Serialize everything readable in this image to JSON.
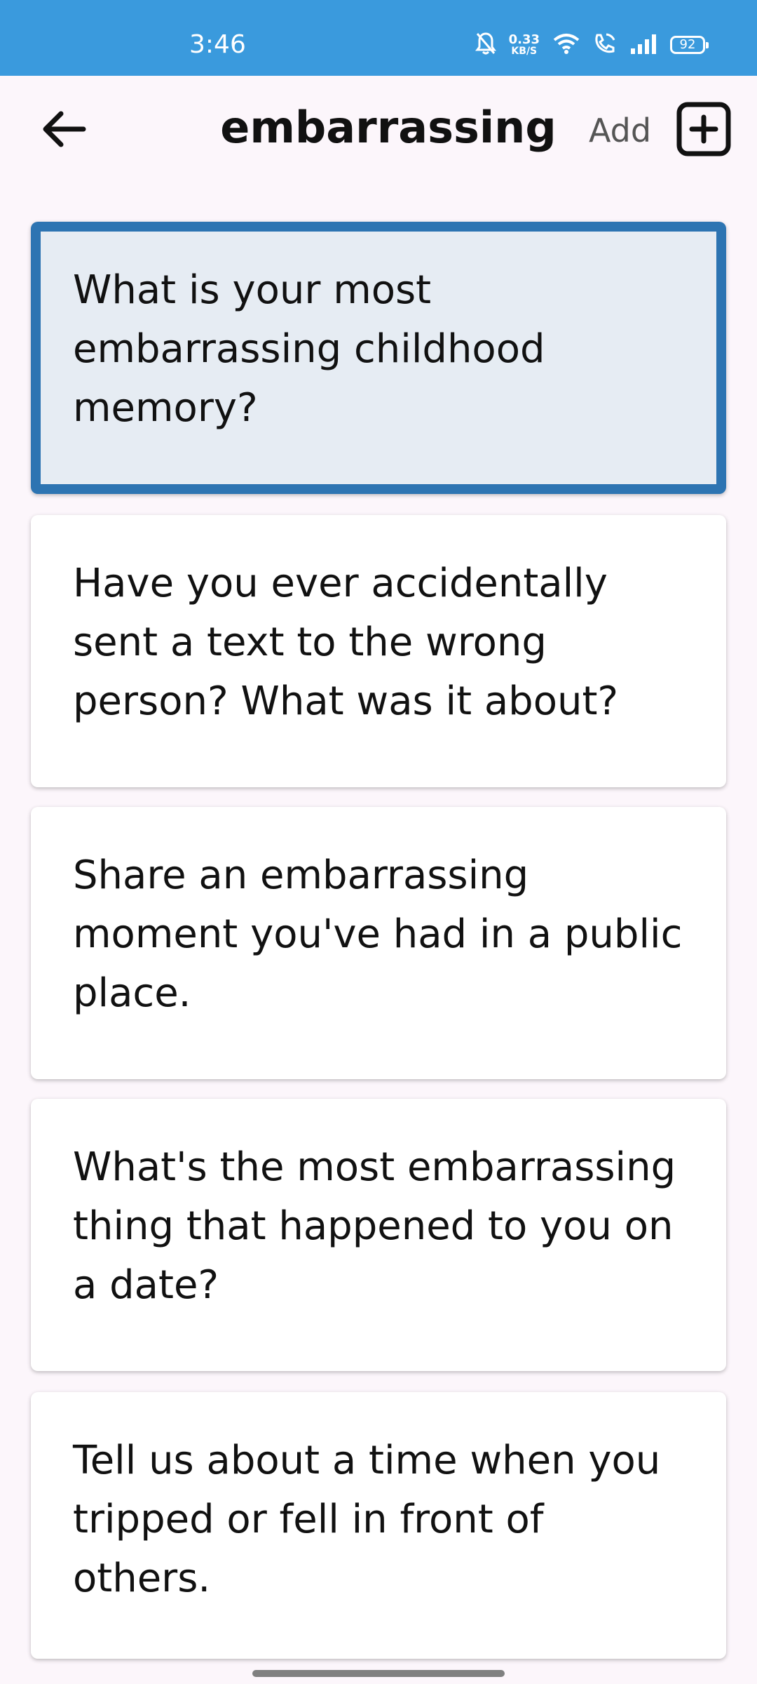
{
  "status_bar": {
    "time": "3:46",
    "net_speed_value": "0.33",
    "net_speed_unit": "KB/S",
    "battery": "92",
    "icons": [
      "bell-off-icon",
      "wifi-icon",
      "wifi-calling-icon",
      "signal-icon",
      "battery-icon"
    ]
  },
  "header": {
    "title": "embarrassing",
    "add_label": "Add",
    "back_icon": "arrow-left-icon",
    "add_icon": "plus-square-icon"
  },
  "colors": {
    "status_bar": "#3a9add",
    "selected_border": "#2d74b2",
    "selected_fill": "#e6ecf3",
    "background": "#fcf6fb"
  },
  "questions": [
    {
      "text": "What is your most embarrassing childhood memory?",
      "selected": true
    },
    {
      "text": "Have you ever accidentally sent a text to the wrong person? What was it about?",
      "selected": false
    },
    {
      "text": "Share an embarrassing moment you've had in a public place.",
      "selected": false
    },
    {
      "text": "What's the most embarrassing thing that happened to you on a date?",
      "selected": false
    },
    {
      "text": "Tell us about a time when you tripped or fell in front of others.",
      "selected": false
    }
  ]
}
